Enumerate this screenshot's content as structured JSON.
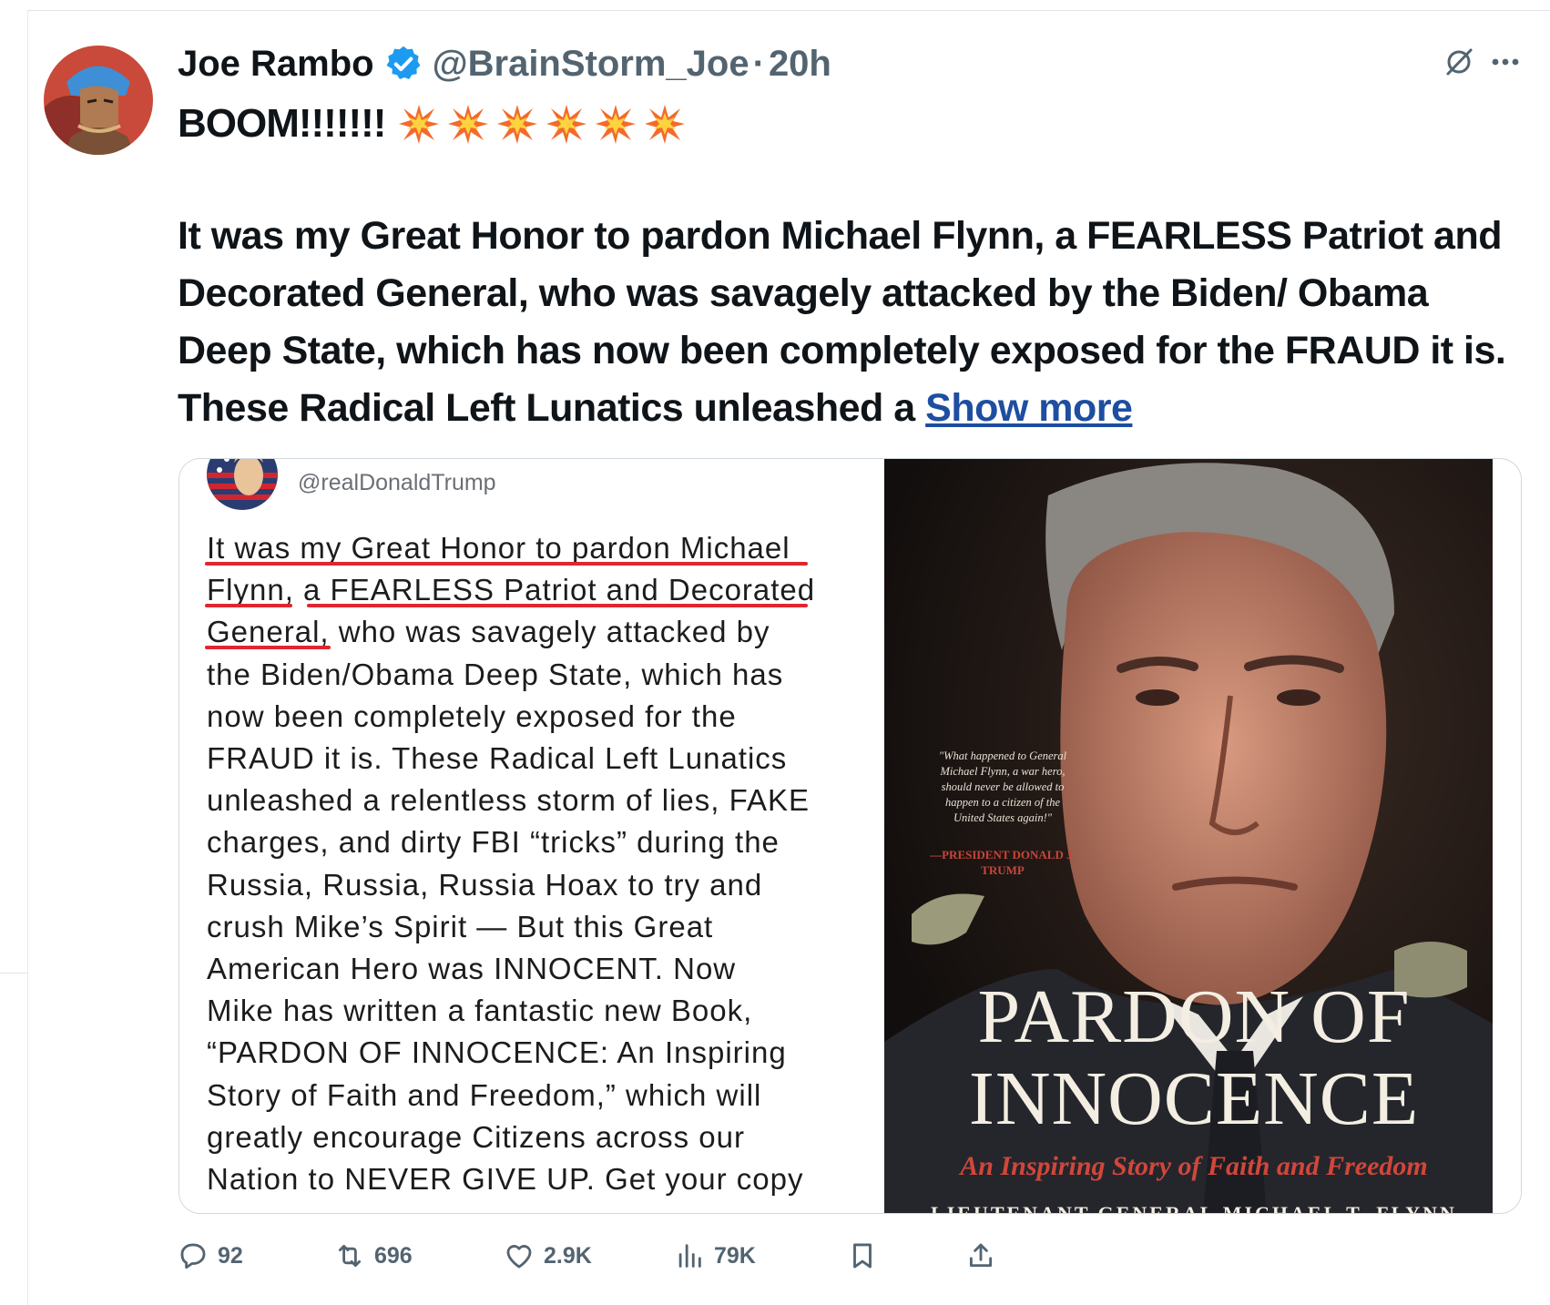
{
  "tweet": {
    "author_name": "Joe Rambo",
    "handle": "@BrainStorm_Joe",
    "separator": "·",
    "time": "20h",
    "boom_text": "BOOM!!!!!!!",
    "body": "It was my Great Honor to pardon Michael Flynn, a FEARLESS Patriot and Decorated General, who was savagely attacked by the Biden/ Obama Deep State, which has now been completely exposed for the FRAUD it is. These Radical Left Lunatics unleashed a",
    "show_more": "Show more"
  },
  "media": {
    "screenshot": {
      "handle": "@realDonaldTrump",
      "lines": [
        "It was my Great Honor to pardon Michael",
        "Flynn, a FEARLESS Patriot and Decorated",
        "General, who was savagely attacked by",
        "the Biden/Obama Deep State, which has",
        "now been completely exposed for the",
        "FRAUD it is. These Radical Left Lunatics",
        "unleashed a relentless storm of lies, FAKE",
        "charges, and dirty FBI “tricks” during the",
        "Russia, Russia, Russia Hoax to try and",
        "crush Mike’s Spirit — But this Great",
        "American Hero was INNOCENT. Now",
        "Mike has written a fantastic new Book,",
        "“PARDON OF INNOCENCE: An Inspiring",
        "Story of Faith and Freedom,” which will",
        "greatly encourage Citizens across our",
        "Nation to NEVER GIVE UP. Get your copy"
      ]
    },
    "book": {
      "quote": "\"What happened to General Michael Flynn, a war hero, should never be allowed to happen to a citizen of the United States again!\"",
      "quote_attribution": "—PRESIDENT DONALD J. TRUMP",
      "title_line1": "PARDON OF",
      "title_line2": "INNOCENCE",
      "subtitle": "An Inspiring Story of Faith and Freedom",
      "author": "LIEUTENANT GENERAL MICHAEL T. FLYNN"
    }
  },
  "actions": {
    "replies": "92",
    "reposts": "696",
    "likes": "2.9K",
    "views": "79K"
  },
  "colors": {
    "text": "#0f1419",
    "muted": "#536471",
    "verified_blue": "#1d9bf0",
    "link": "#1d4ea1",
    "underline_red": "#e0262e"
  }
}
